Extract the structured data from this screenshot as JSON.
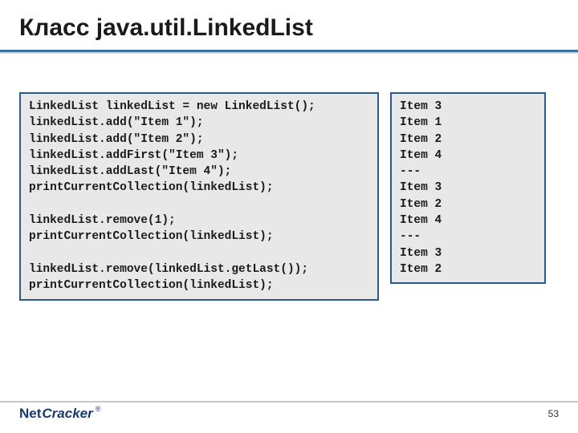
{
  "title": "Класс java.util.LinkedList",
  "code_left": "LinkedList linkedList = new LinkedList();\nlinkedList.add(\"Item 1\");\nlinkedList.add(\"Item 2\");\nlinkedList.addFirst(\"Item 3\");\nlinkedList.addLast(\"Item 4\");\nprintCurrentCollection(linkedList);\n\nlinkedList.remove(1);\nprintCurrentCollection(linkedList);\n\nlinkedList.remove(linkedList.getLast());\nprintCurrentCollection(linkedList);",
  "code_right": "Item 3\nItem 1\nItem 2\nItem 4\n---\nItem 3\nItem 2\nItem 4\n---\nItem 3\nItem 2",
  "footer": {
    "logo_part1": "Net",
    "logo_part2": "Cracker",
    "logo_registered": "®",
    "page_number": "53"
  }
}
